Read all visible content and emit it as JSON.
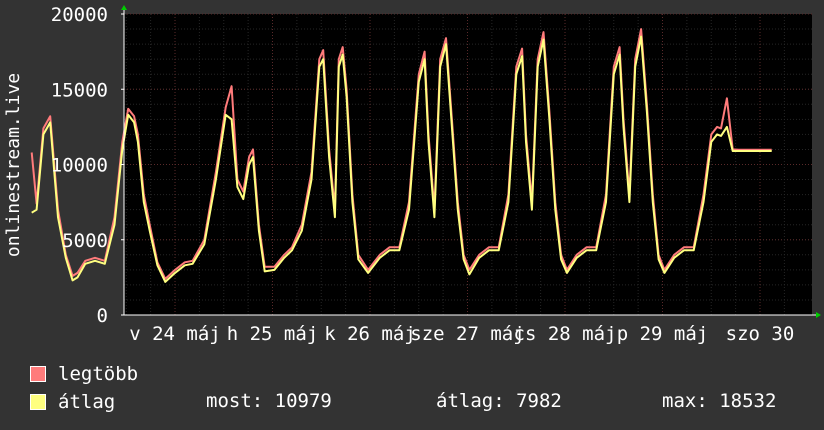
{
  "chart_data": {
    "type": "line",
    "ylabel": "onlinestream.live",
    "ylim": [
      0,
      20000
    ],
    "yticks": [
      0,
      5000,
      10000,
      15000,
      20000
    ],
    "x_tick_labels": [
      "v 24 máj",
      "h 25 máj",
      "k 26 máj",
      "sze 27 máj",
      "cs 28 máj",
      "p 29 máj",
      "szo 30"
    ],
    "x_range": [
      0,
      7
    ],
    "grid": true,
    "colors": {
      "background": "#333333",
      "plot": "#000000",
      "grid": "#2e2e2e",
      "max": "#ff7b7b",
      "avg": "#ffff80",
      "axis": "#ffffff",
      "arrow": "#00cc00"
    },
    "series": [
      {
        "name": "legtöbb",
        "x": [
          -0.47,
          -0.42,
          -0.35,
          -0.28,
          -0.2,
          -0.12,
          -0.05,
          0.0,
          0.08,
          0.18,
          0.28,
          0.38,
          0.46,
          0.52,
          0.58,
          0.62,
          0.68,
          0.74,
          0.82,
          0.9,
          1.0,
          1.1,
          1.18,
          1.3,
          1.42,
          1.52,
          1.58,
          1.64,
          1.7,
          1.76,
          1.8,
          1.86,
          1.92,
          2.02,
          2.12,
          2.2,
          2.3,
          2.4,
          2.48,
          2.52,
          2.58,
          2.64,
          2.68,
          2.72,
          2.76,
          2.82,
          2.88,
          2.98,
          3.1,
          3.2,
          3.3,
          3.4,
          3.5,
          3.56,
          3.6,
          3.66,
          3.72,
          3.78,
          3.84,
          3.9,
          3.96,
          4.02,
          4.12,
          4.22,
          4.32,
          4.42,
          4.5,
          4.56,
          4.6,
          4.66,
          4.72,
          4.78,
          4.84,
          4.9,
          4.96,
          5.02,
          5.12,
          5.22,
          5.32,
          5.42,
          5.5,
          5.56,
          5.6,
          5.66,
          5.72,
          5.78,
          5.84,
          5.9,
          5.96,
          6.02,
          6.12,
          6.22,
          6.32,
          6.42,
          6.5,
          6.56,
          6.6,
          6.66,
          6.72,
          6.78,
          6.84,
          6.9,
          6.96,
          7.02,
          7.08,
          7.12
        ],
        "values": [
          10800,
          7400,
          12400,
          13200,
          7000,
          4000,
          2600,
          2800,
          3600,
          3800,
          3600,
          6500,
          11500,
          13700,
          13200,
          12000,
          8000,
          6000,
          3500,
          2400,
          3000,
          3500,
          3600,
          5000,
          9500,
          13800,
          15200,
          9000,
          8200,
          10500,
          11000,
          6000,
          3200,
          3200,
          4000,
          4500,
          6000,
          9500,
          17000,
          17600,
          11000,
          7000,
          17000,
          17800,
          15000,
          8000,
          4000,
          3000,
          4000,
          4500,
          4500,
          7500,
          16000,
          17500,
          12000,
          7000,
          17000,
          18400,
          13000,
          7500,
          4000,
          3000,
          4000,
          4500,
          4500,
          8000,
          16500,
          17700,
          12000,
          7500,
          17000,
          18800,
          13500,
          7500,
          4000,
          3000,
          4000,
          4500,
          4500,
          8000,
          16500,
          17800,
          13000,
          8000,
          17000,
          19000,
          14000,
          8000,
          4000,
          3000,
          4000,
          4500,
          4500,
          8000,
          12000,
          12500,
          12400,
          14400,
          11000,
          10979,
          10979,
          10979,
          10979,
          10979,
          10979,
          10979
        ],
        "color": "#ff7b7b"
      },
      {
        "name": "átlag",
        "x": [
          -0.47,
          -0.42,
          -0.35,
          -0.28,
          -0.2,
          -0.12,
          -0.05,
          0.0,
          0.08,
          0.18,
          0.28,
          0.38,
          0.46,
          0.52,
          0.58,
          0.62,
          0.68,
          0.74,
          0.82,
          0.9,
          1.0,
          1.1,
          1.18,
          1.3,
          1.42,
          1.52,
          1.58,
          1.64,
          1.7,
          1.76,
          1.8,
          1.86,
          1.92,
          2.02,
          2.12,
          2.2,
          2.3,
          2.4,
          2.48,
          2.52,
          2.58,
          2.64,
          2.68,
          2.72,
          2.76,
          2.82,
          2.88,
          2.98,
          3.1,
          3.2,
          3.3,
          3.4,
          3.5,
          3.56,
          3.6,
          3.66,
          3.72,
          3.78,
          3.84,
          3.9,
          3.96,
          4.02,
          4.12,
          4.22,
          4.32,
          4.42,
          4.5,
          4.56,
          4.6,
          4.66,
          4.72,
          4.78,
          4.84,
          4.9,
          4.96,
          5.02,
          5.12,
          5.22,
          5.32,
          5.42,
          5.5,
          5.56,
          5.6,
          5.66,
          5.72,
          5.78,
          5.84,
          5.9,
          5.96,
          6.02,
          6.12,
          6.22,
          6.32,
          6.42,
          6.5,
          6.56,
          6.6,
          6.66,
          6.72,
          6.78,
          6.84,
          6.9,
          6.96,
          7.02,
          7.08,
          7.12
        ],
        "values": [
          6800,
          7000,
          12000,
          12800,
          6500,
          3800,
          2300,
          2500,
          3400,
          3600,
          3400,
          6000,
          11000,
          13300,
          12800,
          11500,
          7500,
          5600,
          3300,
          2200,
          2800,
          3300,
          3400,
          4700,
          9000,
          13300,
          13000,
          8500,
          7700,
          10000,
          10500,
          5600,
          2900,
          3000,
          3800,
          4300,
          5600,
          9000,
          16500,
          17000,
          10500,
          6500,
          16500,
          17300,
          14500,
          7500,
          3700,
          2800,
          3800,
          4300,
          4300,
          7000,
          15500,
          17000,
          11500,
          6500,
          16500,
          18000,
          12500,
          7000,
          3700,
          2700,
          3800,
          4300,
          4300,
          7500,
          16000,
          17200,
          11500,
          7000,
          16500,
          18300,
          13000,
          7000,
          3700,
          2800,
          3800,
          4300,
          4300,
          7500,
          16000,
          17300,
          12500,
          7500,
          16500,
          18500,
          13500,
          7500,
          3700,
          2800,
          3800,
          4300,
          4300,
          7500,
          11500,
          12000,
          11900,
          12500,
          10900,
          10900,
          10900,
          10900,
          10900,
          10900,
          10900,
          10900
        ],
        "color": "#ffff80"
      }
    ]
  },
  "legend": {
    "max_label": "legtöbb",
    "avg_label": "átlag"
  },
  "stats": {
    "now": "most: 10979",
    "avg": "átlag: 7982",
    "max": "max: 18532"
  }
}
